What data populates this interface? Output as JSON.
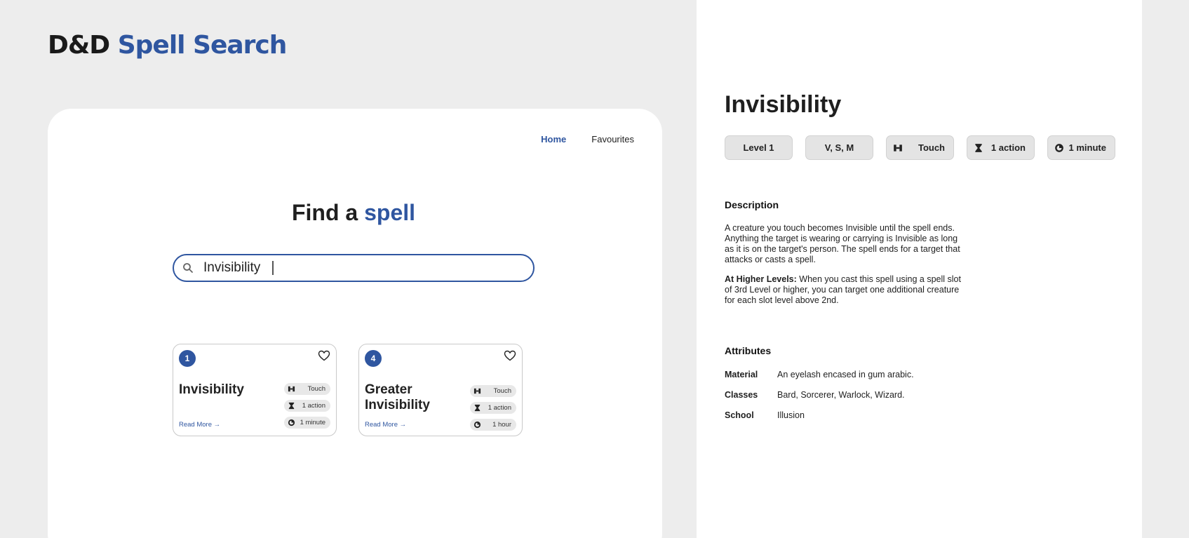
{
  "app": {
    "title_part1": "D&D",
    "title_part2": "Spell Search"
  },
  "nav": {
    "home": "Home",
    "favourites": "Favourites"
  },
  "search": {
    "heading_part1": "Find a",
    "heading_part2": "spell",
    "value": "Invisibility",
    "placeholder": ""
  },
  "results": [
    {
      "level": "1",
      "name": "Invisibility",
      "range": "Touch",
      "casting_time": "1 action",
      "duration": "1 minute",
      "read_more": "Read More →"
    },
    {
      "level": "4",
      "name": "Greater Invisibility",
      "range": "Touch",
      "casting_time": "1 action",
      "duration": "1 hour",
      "read_more": "Read More →"
    }
  ],
  "detail": {
    "title": "Invisibility",
    "level": "Level 1",
    "components": "V, S, M",
    "range": "Touch",
    "casting_time": "1 action",
    "duration": "1 minute",
    "description_heading": "Description",
    "description": "A creature you touch becomes Invisible until the spell ends. Anything the target is wearing or carrying is Invisible as long as it is on the target's person. The spell ends for a target that attacks or casts a spell.",
    "higher_levels_label": "At Higher Levels:",
    "higher_levels_text": "When you cast this spell using a spell slot of 3rd Level or higher, you can target one additional creature for each slot level above 2nd.",
    "attributes_heading": "Attributes",
    "attributes": [
      {
        "key": "Material",
        "value": "An eyelash encased in gum arabic."
      },
      {
        "key": "Classes",
        "value": "Bard, Sorcerer, Warlock, Wizard."
      },
      {
        "key": "School",
        "value": "Illusion"
      }
    ]
  },
  "colors": {
    "accent": "#2f56a0",
    "background": "#ededed",
    "panel": "#ffffff"
  },
  "icons": {
    "range": "range-icon",
    "casting_time": "hourglass-icon",
    "duration": "clock-icon",
    "search": "search-icon",
    "favourite": "heart-icon"
  }
}
